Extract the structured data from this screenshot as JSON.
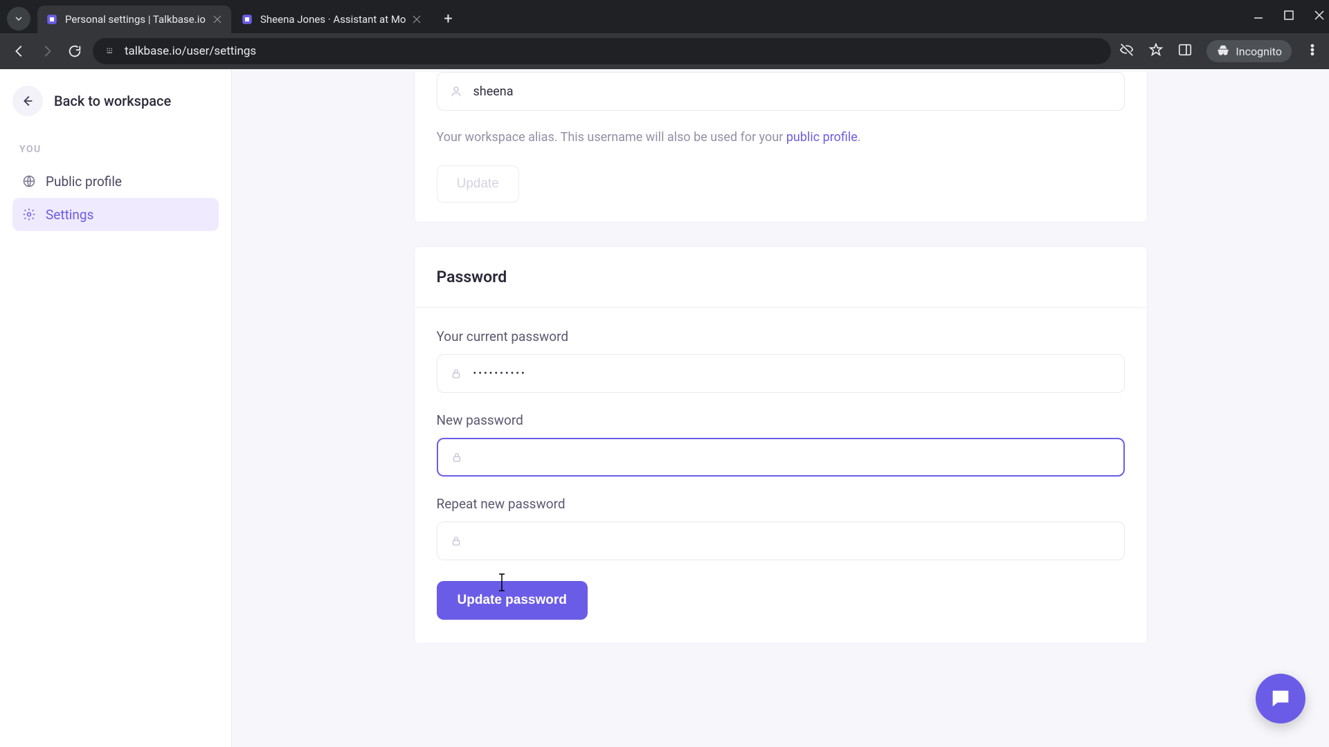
{
  "browser": {
    "tabs": [
      {
        "title": "Personal settings | Talkbase.io"
      },
      {
        "title": "Sheena Jones · Assistant at Mo"
      }
    ],
    "url": "talkbase.io/user/settings",
    "incognito_label": "Incognito"
  },
  "sidebar": {
    "back_label": "Back to workspace",
    "section_label": "YOU",
    "items": [
      {
        "label": "Public profile"
      },
      {
        "label": "Settings"
      }
    ]
  },
  "username": {
    "value": "sheena",
    "helper_prefix": "Your workspace alias. This username will also be used for your ",
    "helper_link": "public profile",
    "helper_suffix": ".",
    "update_label": "Update"
  },
  "password": {
    "heading": "Password",
    "current_label": "Your current password",
    "current_value_mask": "••••••••••",
    "new_label": "New password",
    "new_value": "",
    "repeat_label": "Repeat new password",
    "repeat_value": "",
    "submit_label": "Update password"
  }
}
